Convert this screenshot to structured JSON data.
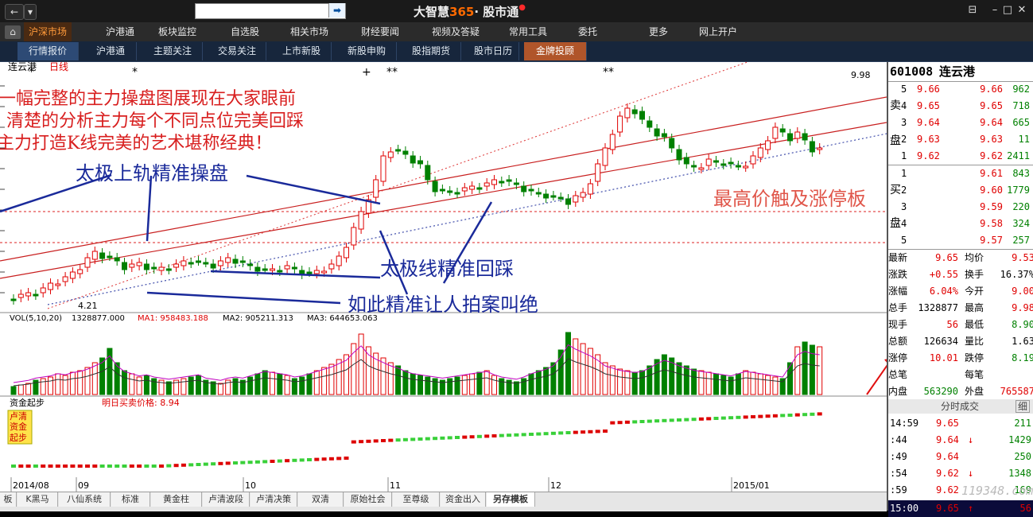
{
  "window": {
    "title_main": "大智慧",
    "title_num": "365",
    "title_sep": "·",
    "title_sub": "股市通",
    "title_dot": "●",
    "back_glyph": "←",
    "dropdown_glyph": "▾",
    "go_glyph": "➡",
    "win_controls": [
      "⊟",
      "–",
      "□",
      "✕"
    ]
  },
  "home_glyph": "⌂",
  "main_menu": [
    "沪深市场",
    "沪港通",
    "板块监控",
    "自选股",
    "相关市场",
    "财经要闻",
    "视频及答疑",
    "常用工具",
    "委托",
    "更多",
    "网上开户"
  ],
  "sub_menu": [
    "行情报价",
    "沪港通",
    "主题关注",
    "交易关注",
    "上市新股",
    "新股申购",
    "股指期货",
    "股市日历",
    "金牌投顾"
  ],
  "chart": {
    "stock_label": "连云港",
    "period_label": "日线",
    "high_marker": "9.98",
    "low_marker": "4.21",
    "vol_legend": {
      "name": "VOL(5,10,20)",
      "vol": "1328877.000",
      "ma1": "MA1: 958483.188",
      "ma2": "MA2: 905211.313",
      "ma3": "MA3: 644653.063"
    },
    "fund_panel": {
      "name": "资金起步",
      "buy_price": "明日买卖价格: 8.94",
      "legend": [
        "卢清",
        "资金",
        "起步"
      ]
    },
    "date_labels": [
      "2014/08",
      "09",
      "10",
      "11",
      "12",
      "2015/01"
    ],
    "markers": [
      "*",
      "*",
      "+",
      "**",
      "**"
    ]
  },
  "annotations": {
    "line1": "一幅完整的主力操盘图展现在大家眼前",
    "line2": "清楚的分析主力每个不同点位完美回踩",
    "line3": "主力打造K线完美的艺术堪称经典！",
    "taiji_top": "太极上轨精准操盘",
    "taiji_line": "太极线精准回踩",
    "precise": "如此精准让人拍案叫绝",
    "highest": "最高价触及涨停板"
  },
  "bottom_tabs": [
    "板",
    "K黑马",
    "八仙系统",
    "标准",
    "黄金柱",
    "卢清波段",
    "卢清决策",
    "双清",
    "原始社会",
    "至尊级",
    "资金出入",
    "另存模板"
  ],
  "quote": {
    "code": "601008",
    "name": "连云港",
    "sell_label": [
      "卖",
      "盘"
    ],
    "buy_label": [
      "买",
      "盘"
    ],
    "sell": [
      {
        "level": "5",
        "price": "9.66",
        "vol": "962"
      },
      {
        "level": "4",
        "price": "9.65",
        "vol": "718"
      },
      {
        "level": "3",
        "price": "9.64",
        "vol": "665"
      },
      {
        "level": "2",
        "price": "9.63",
        "vol": "11"
      },
      {
        "level": "1",
        "price": "9.62",
        "vol": "2411"
      }
    ],
    "buy": [
      {
        "level": "1",
        "price": "9.61",
        "vol": "843"
      },
      {
        "level": "2",
        "price": "9.60",
        "vol": "1779"
      },
      {
        "level": "3",
        "price": "9.59",
        "vol": "220"
      },
      {
        "level": "4",
        "price": "9.58",
        "vol": "324"
      },
      {
        "level": "5",
        "price": "9.57",
        "vol": "257"
      }
    ],
    "stats": [
      {
        "k1": "最新",
        "v1": "9.65",
        "c1": "up",
        "k2": "均价",
        "v2": "9.53",
        "c2": "up"
      },
      {
        "k1": "涨跌",
        "v1": "+0.55",
        "c1": "up",
        "k2": "换手",
        "v2": "16.37%",
        "c2": "bk"
      },
      {
        "k1": "涨幅",
        "v1": "6.04%",
        "c1": "up",
        "k2": "今开",
        "v2": "9.00",
        "c2": "up"
      },
      {
        "k1": "总手",
        "v1": "1328877",
        "c1": "bk",
        "k2": "最高",
        "v2": "9.98",
        "c2": "up"
      },
      {
        "k1": "现手",
        "v1": "56",
        "c1": "up",
        "k2": "最低",
        "v2": "8.90",
        "c2": "dn"
      },
      {
        "k1": "总额",
        "v1": "126634",
        "c1": "bk",
        "k2": "量比",
        "v2": "1.63",
        "c2": "bk"
      },
      {
        "k1": "涨停",
        "v1": "10.01",
        "c1": "up",
        "k2": "跌停",
        "v2": "8.19",
        "c2": "dn"
      },
      {
        "k1": "总笔",
        "v1": "",
        "c1": "bk",
        "k2": "每笔",
        "v2": "",
        "c2": "bk"
      },
      {
        "k1": "内盘",
        "v1": "563290",
        "c1": "dn",
        "k2": "外盘",
        "v2": "765587",
        "c2": "up"
      }
    ],
    "ticks_header": "分时成交",
    "ticks_detail": "细",
    "ticks": [
      {
        "time": "14:59",
        "price": "9.65",
        "arrow": "",
        "vol": "211",
        "pc": "up",
        "vc": "dn"
      },
      {
        "time": ":44",
        "price": "9.64",
        "arrow": "↓",
        "vol": "1429",
        "pc": "up",
        "vc": "dn"
      },
      {
        "time": ":49",
        "price": "9.64",
        "arrow": "",
        "vol": "250",
        "pc": "up",
        "vc": "dn"
      },
      {
        "time": ":54",
        "price": "9.62",
        "arrow": "↓",
        "vol": "1348",
        "pc": "up",
        "vc": "dn"
      },
      {
        "time": ":59",
        "price": "9.62",
        "arrow": "",
        "vol": "169",
        "pc": "up",
        "vc": "dn"
      },
      {
        "time": "15:00",
        "price": "9.65",
        "arrow": "↑",
        "vol": "56",
        "pc": "up",
        "vc": "up"
      }
    ],
    "watermark": "119348.com"
  },
  "colors": {
    "up": "#e00000",
    "down": "#008000",
    "menu_active": "#ff9a3a",
    "sub_gold": "#b0552a"
  }
}
